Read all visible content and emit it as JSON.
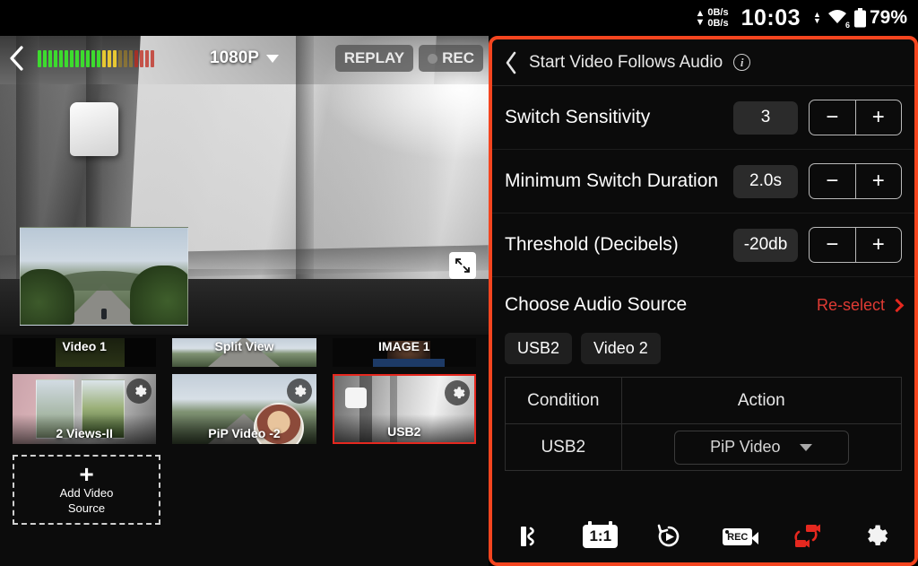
{
  "statusbar": {
    "upload_speed": "0B/s",
    "download_speed": "0B/s",
    "time": "10:03",
    "wifi_generation": "6",
    "battery": "79%"
  },
  "preview": {
    "resolution": "1080P",
    "replay_label": "REPLAY",
    "rec_label": "REC",
    "audio_meter_levels": 22
  },
  "sources": {
    "partial_row": [
      {
        "label": "Video 1"
      },
      {
        "label": "Split View"
      },
      {
        "label": "IMAGE 1"
      }
    ],
    "main_row": [
      {
        "label": "2 Views-II",
        "selected": false
      },
      {
        "label": "PiP Video -2",
        "selected": false
      },
      {
        "label": "USB2",
        "selected": true
      }
    ],
    "add_source": {
      "line1": "Add Video",
      "line2": "Source",
      "plus": "+"
    }
  },
  "panel": {
    "title": "Start Video Follows Audio",
    "settings": [
      {
        "label": "Switch Sensitivity",
        "value": "3",
        "minus": "−",
        "plus": "+"
      },
      {
        "label": "Minimum Switch Duration",
        "value": "2.0s",
        "minus": "−",
        "plus": "+"
      },
      {
        "label": "Threshold (Decibels)",
        "value": "-20db",
        "minus": "−",
        "plus": "+"
      }
    ],
    "audio_source": {
      "label": "Choose Audio Source",
      "reselect_label": "Re-select",
      "chips": [
        "USB2",
        "Video 2"
      ]
    },
    "rules_table": {
      "headers": [
        "Condition",
        "Action"
      ],
      "rows": [
        {
          "condition": "USB2",
          "action": "PiP Video"
        }
      ]
    },
    "toolbar": [
      {
        "name": "audio-levels",
        "label": ""
      },
      {
        "name": "aspect-ratio",
        "label": "1:1"
      },
      {
        "name": "replay",
        "label": ""
      },
      {
        "name": "record",
        "label": "REC"
      },
      {
        "name": "switch-video",
        "label": ""
      },
      {
        "name": "settings",
        "label": ""
      }
    ]
  },
  "colors": {
    "accent_border": "#f4451f",
    "selection_red": "#e5281f",
    "link_red": "#e03b34",
    "panel_bg": "#0b0b0b"
  }
}
